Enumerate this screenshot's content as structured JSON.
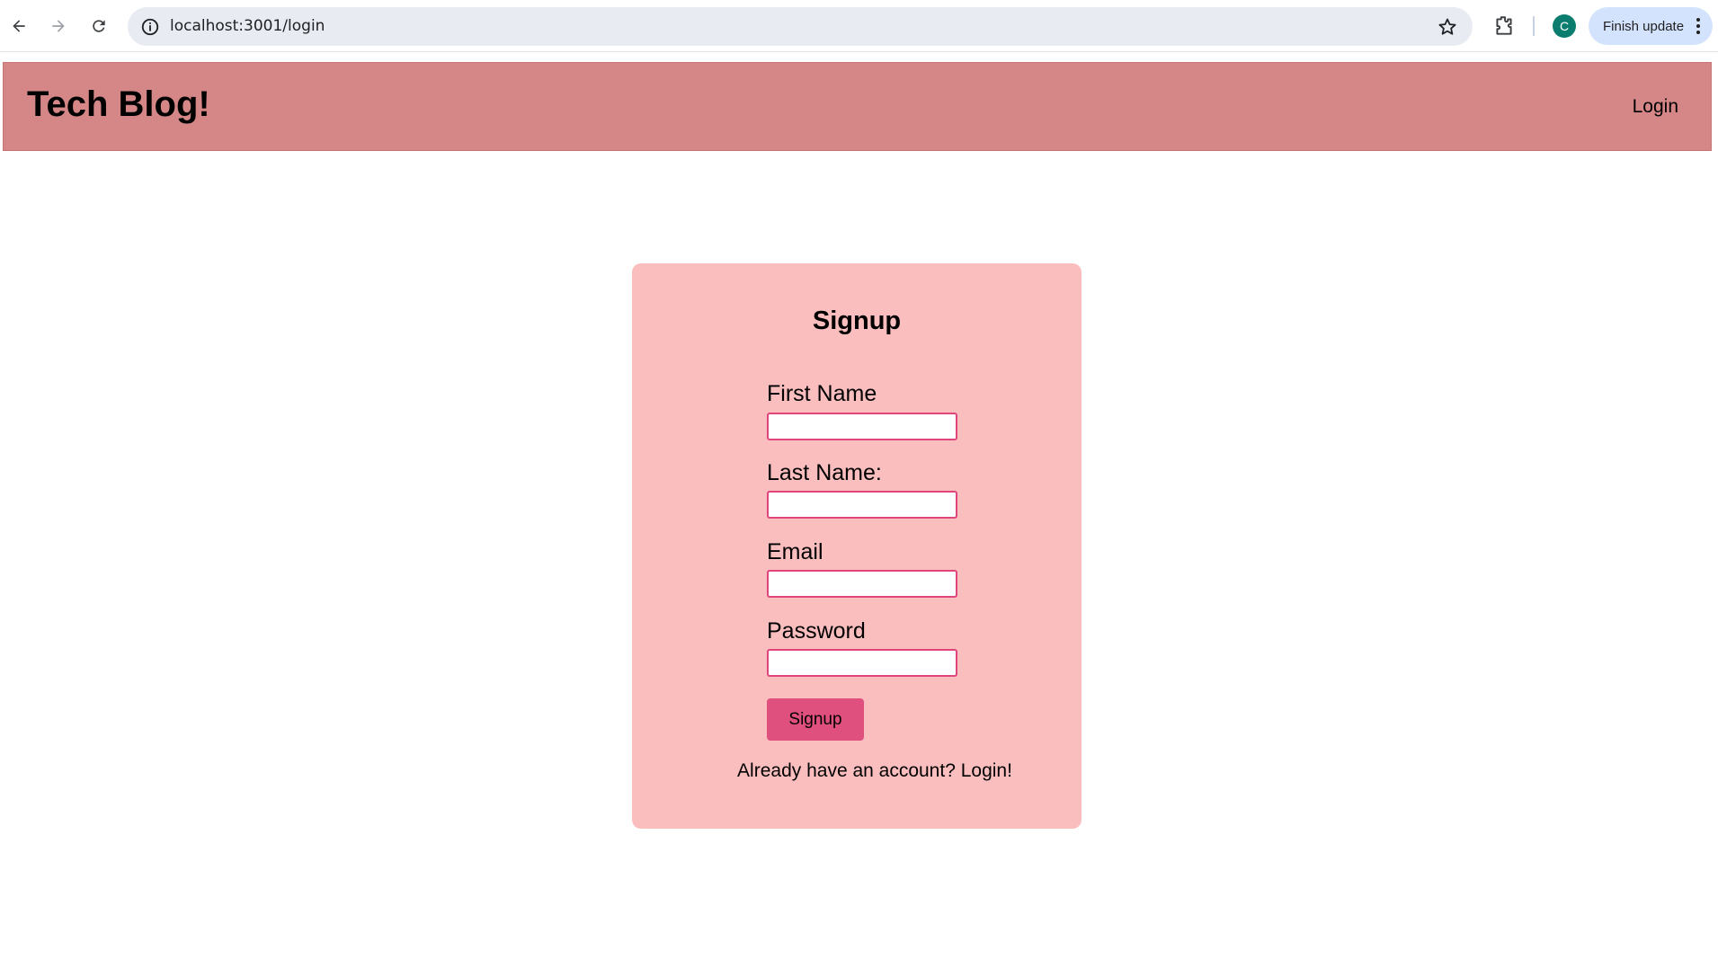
{
  "browser": {
    "url": "localhost:3001/login",
    "profile_initial": "C",
    "finish_update_label": "Finish update",
    "icons": [
      "back-icon",
      "forward-icon",
      "reload-icon",
      "info-icon",
      "star-icon",
      "extensions-icon",
      "more-vert-icon"
    ]
  },
  "header": {
    "title": "Tech Blog!",
    "login_link": "Login",
    "background_color": "#d58787"
  },
  "signup": {
    "heading": "Signup",
    "card_color": "#fbbebe",
    "fields": [
      {
        "label": "First Name",
        "value": "",
        "placeholder": ""
      },
      {
        "label": "Last Name:",
        "value": "",
        "placeholder": ""
      },
      {
        "label": "Email",
        "value": "",
        "placeholder": ""
      },
      {
        "label": "Password",
        "value": "",
        "placeholder": ""
      }
    ],
    "submit_label": "Signup",
    "button_color": "#e0507f",
    "login_prompt": "Already have an account? Login!"
  }
}
